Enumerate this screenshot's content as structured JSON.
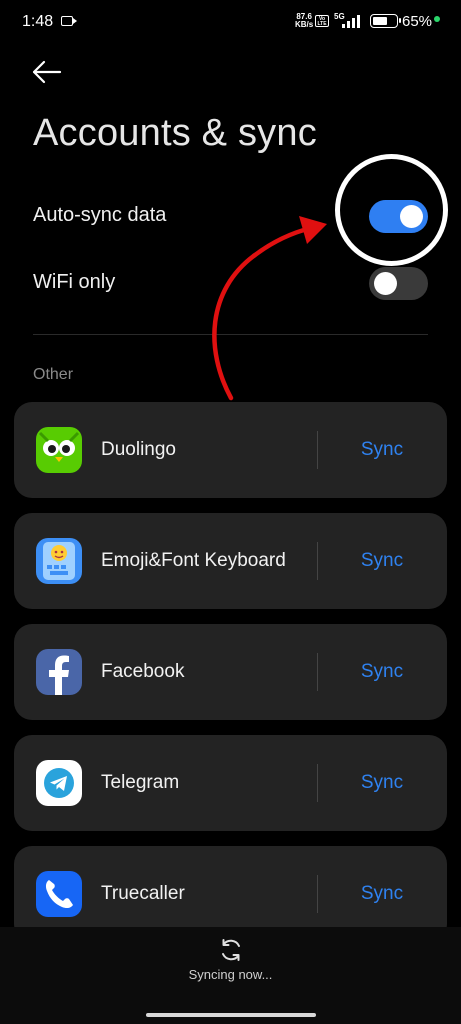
{
  "status_bar": {
    "time": "1:48",
    "speed_value": "87.6",
    "speed_unit": "KB/s",
    "volte": "Vo LTE",
    "network": "5G",
    "battery_percent": "65%",
    "battery_level": 0.65
  },
  "header": {
    "title": "Accounts & sync"
  },
  "settings": {
    "auto_sync": {
      "label": "Auto-sync data",
      "enabled": true
    },
    "wifi_only": {
      "label": "WiFi only",
      "enabled": false
    }
  },
  "section": {
    "other_label": "Other"
  },
  "apps": [
    {
      "name": "Duolingo",
      "sync_label": "Sync",
      "icon": "duolingo-icon"
    },
    {
      "name": "Emoji&Font Keyboard",
      "sync_label": "Sync",
      "icon": "emoji-keyboard-icon"
    },
    {
      "name": "Facebook",
      "sync_label": "Sync",
      "icon": "facebook-icon"
    },
    {
      "name": "Telegram",
      "sync_label": "Sync",
      "icon": "telegram-icon"
    },
    {
      "name": "Truecaller",
      "sync_label": "Sync",
      "icon": "truecaller-icon"
    }
  ],
  "footer": {
    "status": "Syncing now..."
  },
  "colors": {
    "accent": "#2f7ff2",
    "sync_text": "#2f82f0",
    "card_bg": "#232323",
    "annotation_arrow": "#e01010"
  }
}
